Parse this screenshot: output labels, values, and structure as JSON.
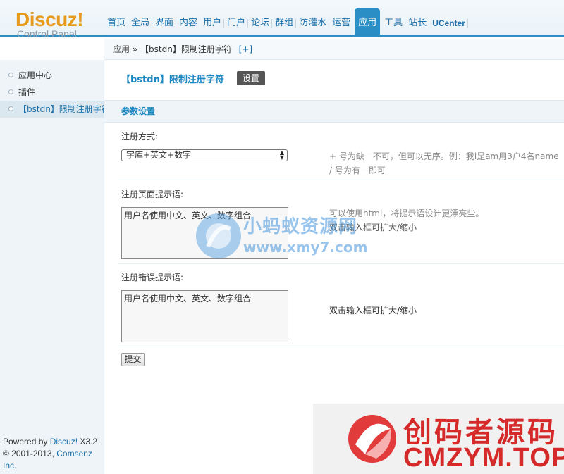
{
  "logo": {
    "brand": "Discuz!",
    "subtitle": "Control Panel"
  },
  "topnav": {
    "items": [
      {
        "label": "首页"
      },
      {
        "label": "全局"
      },
      {
        "label": "界面"
      },
      {
        "label": "内容"
      },
      {
        "label": "用户"
      },
      {
        "label": "门户"
      },
      {
        "label": "论坛"
      },
      {
        "label": "群组"
      },
      {
        "label": "防灌水"
      },
      {
        "label": "运营"
      },
      {
        "label": "应用",
        "active": true
      },
      {
        "label": "工具"
      },
      {
        "label": "站长"
      },
      {
        "label": "UCenter"
      }
    ]
  },
  "breadcrumb": {
    "root": "应用",
    "separator": "»",
    "current": "【bstdn】限制注册字符",
    "add": "[+]"
  },
  "sidebar": {
    "items": [
      {
        "label": "应用中心"
      },
      {
        "label": "插件"
      },
      {
        "label": "【bstdn】限制注册字符",
        "current": true
      }
    ],
    "powered_prefix": "Powered by ",
    "powered_brand": "Discuz!",
    "powered_version": " X3.2",
    "copyright_prefix": "© 2001-2013, ",
    "copyright_company": "Comsenz Inc."
  },
  "page": {
    "title": "【bstdn】限制注册字符",
    "settings_button": "设置",
    "section": "参数设置"
  },
  "form": {
    "reg_mode": {
      "label": "注册方式:",
      "selected": "字库+英文+数字",
      "hint_line1": "+ 号为缺一不可，但可以无序。例：我i是am用3户4名name",
      "hint_line2": "/ 号为有一即可"
    },
    "reg_tip": {
      "label": "注册页面提示语:",
      "value": "用户名使用中文、英文、数字组合",
      "hint_line1": "可以使用html，将提示语设计更漂亮些。",
      "hint_line2": "双击输入框可扩大/缩小"
    },
    "reg_error": {
      "label": "注册错误提示语:",
      "value": "用户名使用中文、英文、数字组合",
      "hint": "双击输入框可扩大/缩小"
    },
    "submit": "提交"
  },
  "watermarks": {
    "top_cn": "小蚂蚁资源网",
    "top_url": "www.xmy7.com",
    "bottom_cn": "创码者源码",
    "bottom_url": "CMZYM.TOP"
  },
  "colors": {
    "accent": "#2b8fc6",
    "title": "#1c88bf",
    "logo": "#e89a1c",
    "watermark_red": "#d62a2a"
  }
}
